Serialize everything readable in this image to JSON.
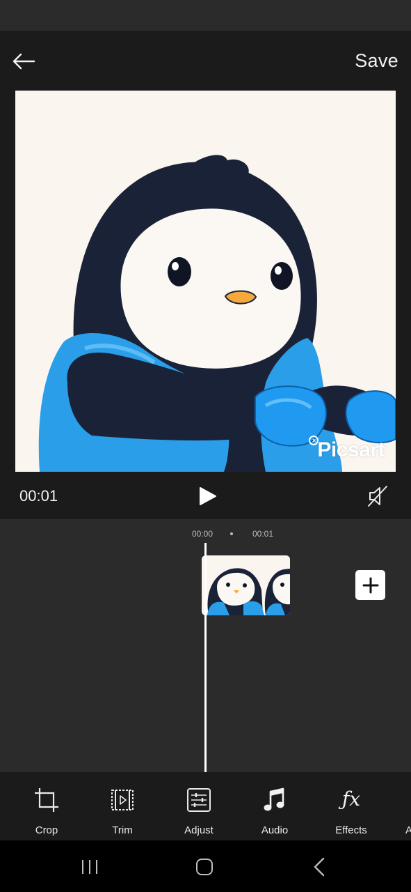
{
  "header": {
    "back_icon": "arrow-left-icon",
    "save_label": "Save"
  },
  "preview": {
    "watermark": "Picsart"
  },
  "player": {
    "current_time": "00:01",
    "play_icon": "play-icon",
    "mute_icon": "speaker-muted-icon"
  },
  "timeline": {
    "ticks": [
      "00:00",
      "00:01"
    ],
    "add_icon": "plus-icon"
  },
  "toolbar": {
    "items": [
      {
        "label": "Crop",
        "icon": "crop-icon"
      },
      {
        "label": "Trim",
        "icon": "trim-icon"
      },
      {
        "label": "Adjust",
        "icon": "adjust-icon"
      },
      {
        "label": "Audio",
        "icon": "music-note-icon"
      },
      {
        "label": "Effects",
        "icon": "fx-icon"
      },
      {
        "label": "A",
        "icon": "cut-off-icon"
      }
    ]
  },
  "colors": {
    "background": "#1b1b1b",
    "timeline_bg": "#2b2b2b",
    "preview_bg": "#faf5ee",
    "penguin_blue": "#2a9ee8"
  }
}
